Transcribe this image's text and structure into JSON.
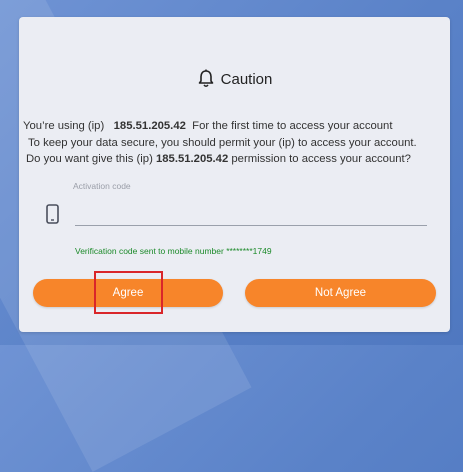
{
  "dialog": {
    "title": "Caution",
    "line1_prefix": "You’re using (ip)",
    "ip": "185.51.205.42",
    "line1_suffix": "For the first time to access your account",
    "line2": "To keep your data secure, you should permit your (ip) to access your account.",
    "line3_prefix": "Do you want give this (ip)",
    "line3_suffix": "permission to access your account?",
    "activation_label": "Activation code",
    "activation_value": "",
    "verification_text": "Verification code sent to mobile number ********1749",
    "agree_label": "Agree",
    "not_agree_label": "Not Agree"
  },
  "icons": {
    "title": "bell-icon",
    "field": "mobile-phone-icon"
  },
  "colors": {
    "button": "#f7852a",
    "verification": "#1c8a2a",
    "highlight": "#d9262a"
  }
}
